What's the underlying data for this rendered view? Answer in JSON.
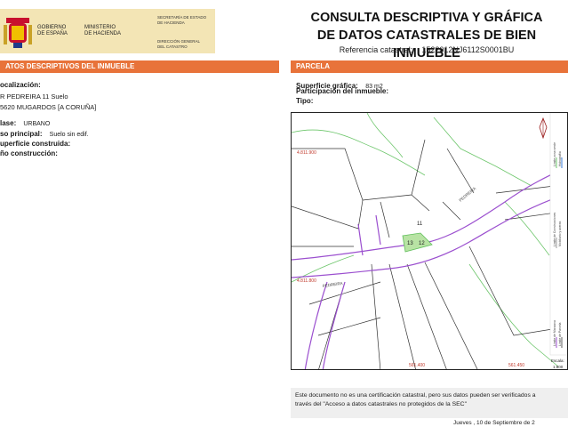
{
  "header": {
    "gobierno": "GOBIERNO\nDE ESPAÑA",
    "ministerio": "MINISTERIO\nDE HACIENDA",
    "secretaria": "SECRETARÍA DE ESTADO\nDE HACIENDA",
    "direccion": "DIRECCIÓN GENERAL\nDEL CATASTRO",
    "title_line1": "CONSULTA DESCRIPTIVA Y GRÁFICA",
    "title_line2": "DE DATOS CATASTRALES DE BIEN INMUEBLE",
    "ref_label": "Referencia catastral:",
    "ref_value": "1522012NJ6112S0001BU"
  },
  "left": {
    "bar": "ATOS DESCRIPTIVOS DEL INMUEBLE",
    "loc_label": "ocalización:",
    "loc_line1": "R PEDREIRA 11 Suelo",
    "loc_line2": "5620 MUGARDOS [A CORUÑA]",
    "clase_label": "lase:",
    "clase_value": "URBANO",
    "uso_label": "so principal:",
    "uso_value": "Suelo sin edif.",
    "sup_label": "uperficie construida:",
    "anio_label": "ño construcción:"
  },
  "right": {
    "bar": "PARCELA",
    "sup_label": "Superficie gráfica:",
    "sup_value": "83 m2",
    "part_label": "Participación del inmueble:",
    "tipo_label": "Tipo:"
  },
  "map": {
    "coord_y1": "4.811.900",
    "coord_y2": "4.811.800",
    "coord_x1": "561.400",
    "coord_x2": "561.450",
    "parcel_11": "11",
    "parcel_12": "12",
    "parcel_13": "13",
    "street1": "PEDREIRA",
    "street2": "PEDREIRA",
    "escala": "Escala:",
    "escala_value": "1:800",
    "legend_1": "Límite de Manzana",
    "legend_2": "Límite de Parcela",
    "legend_3": "Límite de Construcciones",
    "legend_4": "Mobiliario y aceras",
    "legend_5": "Límite zona verde",
    "legend_6": "Hidrografía"
  },
  "notice": {
    "line1": "Este documento no es una certificación catastral, pero sus datos pueden ser verificados a",
    "line2": "través del \"Acceso a datos catastrales no protegidos de la SEC\""
  },
  "footer": {
    "date": "Jueves , 10 de Septiembre de 2"
  },
  "colors": {
    "accent": "#e8733a",
    "plot": "#b8e3a4",
    "street": "#9b4fcf",
    "green": "#5fbf5a"
  }
}
